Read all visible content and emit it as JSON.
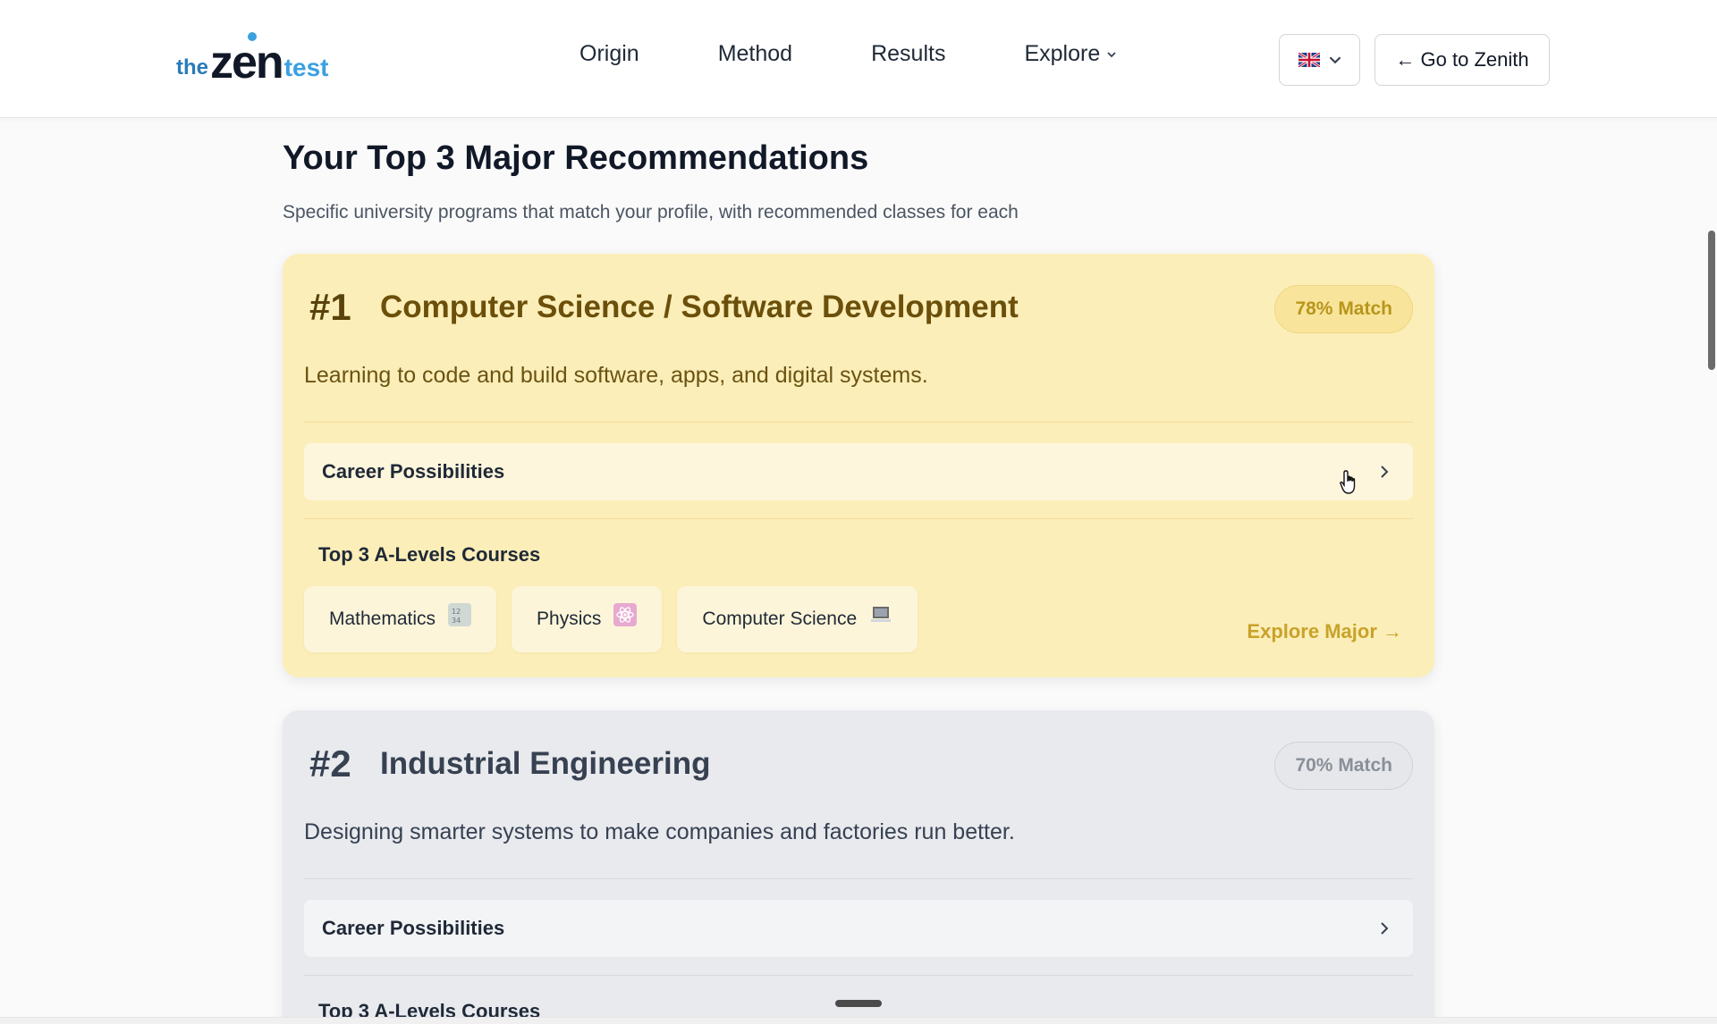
{
  "header": {
    "logo": {
      "the": "the",
      "zen": "zen",
      "test": "test"
    },
    "nav": [
      {
        "label": "Origin"
      },
      {
        "label": "Method"
      },
      {
        "label": "Results"
      },
      {
        "label": "Explore"
      }
    ],
    "language": {
      "flag": "uk-flag-icon"
    },
    "goto_button": "← Go to Zenith"
  },
  "main": {
    "title": "Your Top 3 Major Recommendations",
    "subtitle": "Specific university programs that match your profile, with recommended classes for each",
    "cards": [
      {
        "rank": "#1",
        "name": "Computer Science / Software Development",
        "match": "78% Match",
        "description": "Learning to code and build software, apps, and digital systems.",
        "career_label": "Career Possibilities",
        "courses_title": "Top 3 A-Levels Courses",
        "courses": [
          {
            "label": "Mathematics",
            "icon": "math-icon"
          },
          {
            "label": "Physics",
            "icon": "atom-icon"
          },
          {
            "label": "Computer Science",
            "icon": "laptop-icon"
          }
        ],
        "explore": "Explore Major →"
      },
      {
        "rank": "#2",
        "name": "Industrial Engineering",
        "match": "70% Match",
        "description": "Designing smarter systems to make companies and factories run better.",
        "career_label": "Career Possibilities",
        "courses_title": "Top 3 A-Levels Courses"
      }
    ]
  },
  "colors": {
    "gold_card": "#fbeeb8",
    "gray_card": "#e8eaee",
    "explore_link": "#c9a22a"
  }
}
